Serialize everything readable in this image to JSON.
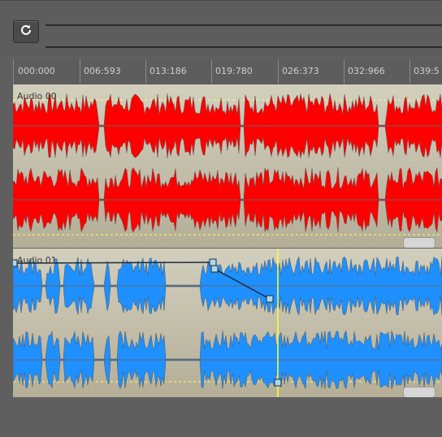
{
  "toolbar": {
    "refresh_icon": "refresh-icon"
  },
  "timeline": {
    "ticks": [
      "000:000",
      "006:593",
      "013:186",
      "019:780",
      "026:373",
      "032:966",
      "039:5"
    ]
  },
  "tracks": [
    {
      "label": "Audio 00",
      "color": "#ff0000"
    },
    {
      "label": "Audio 01",
      "color": "#1e90ff"
    }
  ],
  "colors": {
    "playhead": "#ffff33",
    "envelope_point": "#a8d8f0"
  }
}
